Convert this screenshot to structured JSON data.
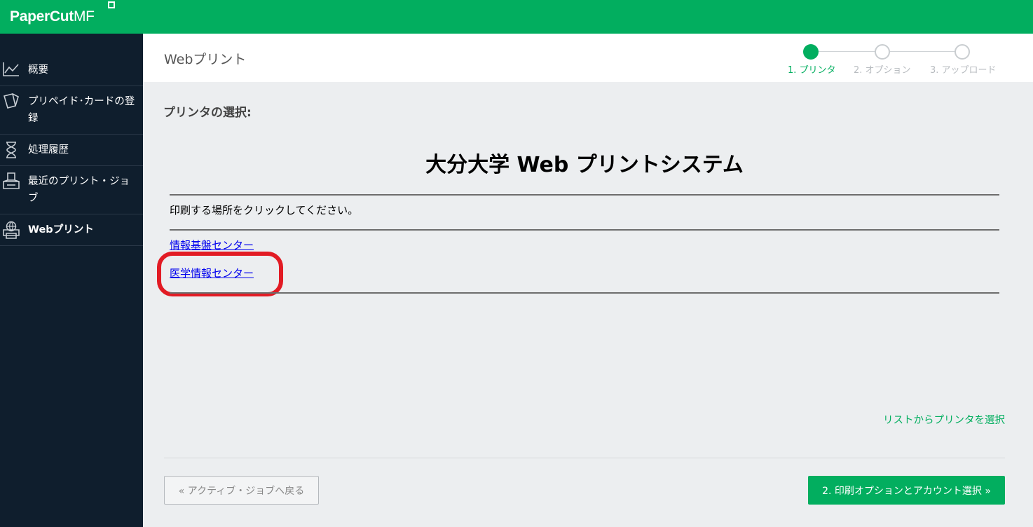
{
  "app": {
    "logo_text": "PaperCut",
    "logo_suffix": "MF",
    "brand_color": "#02ae5f"
  },
  "sidebar": {
    "items": [
      {
        "label": "概要",
        "icon": "line-chart-icon"
      },
      {
        "label": "プリペイド･カードの登録",
        "icon": "cards-icon"
      },
      {
        "label": "処理履歴",
        "icon": "hourglass-icon"
      },
      {
        "label": "最近のプリント・ジョブ",
        "icon": "printer-tray-icon"
      },
      {
        "label": "Webプリント",
        "icon": "web-printer-icon",
        "active": true
      }
    ]
  },
  "header": {
    "title": "Webプリント",
    "steps": [
      {
        "label": "1. プリンタ",
        "state": "active"
      },
      {
        "label": "2. オプション",
        "state": "inactive"
      },
      {
        "label": "3. アップロード",
        "state": "inactive"
      }
    ]
  },
  "main": {
    "section_title": "プリンタの選択:",
    "heading": "大分大学 Web プリントシステム",
    "instruction": "印刷する場所をクリックしてください。",
    "locations": [
      "情報基盤センター",
      "医学情報センター"
    ],
    "list_link": "リストからプリンタを選択",
    "back_button": "« アクティブ・ジョブへ戻る",
    "next_button": "2. 印刷オプションとアカウント選択 »"
  }
}
